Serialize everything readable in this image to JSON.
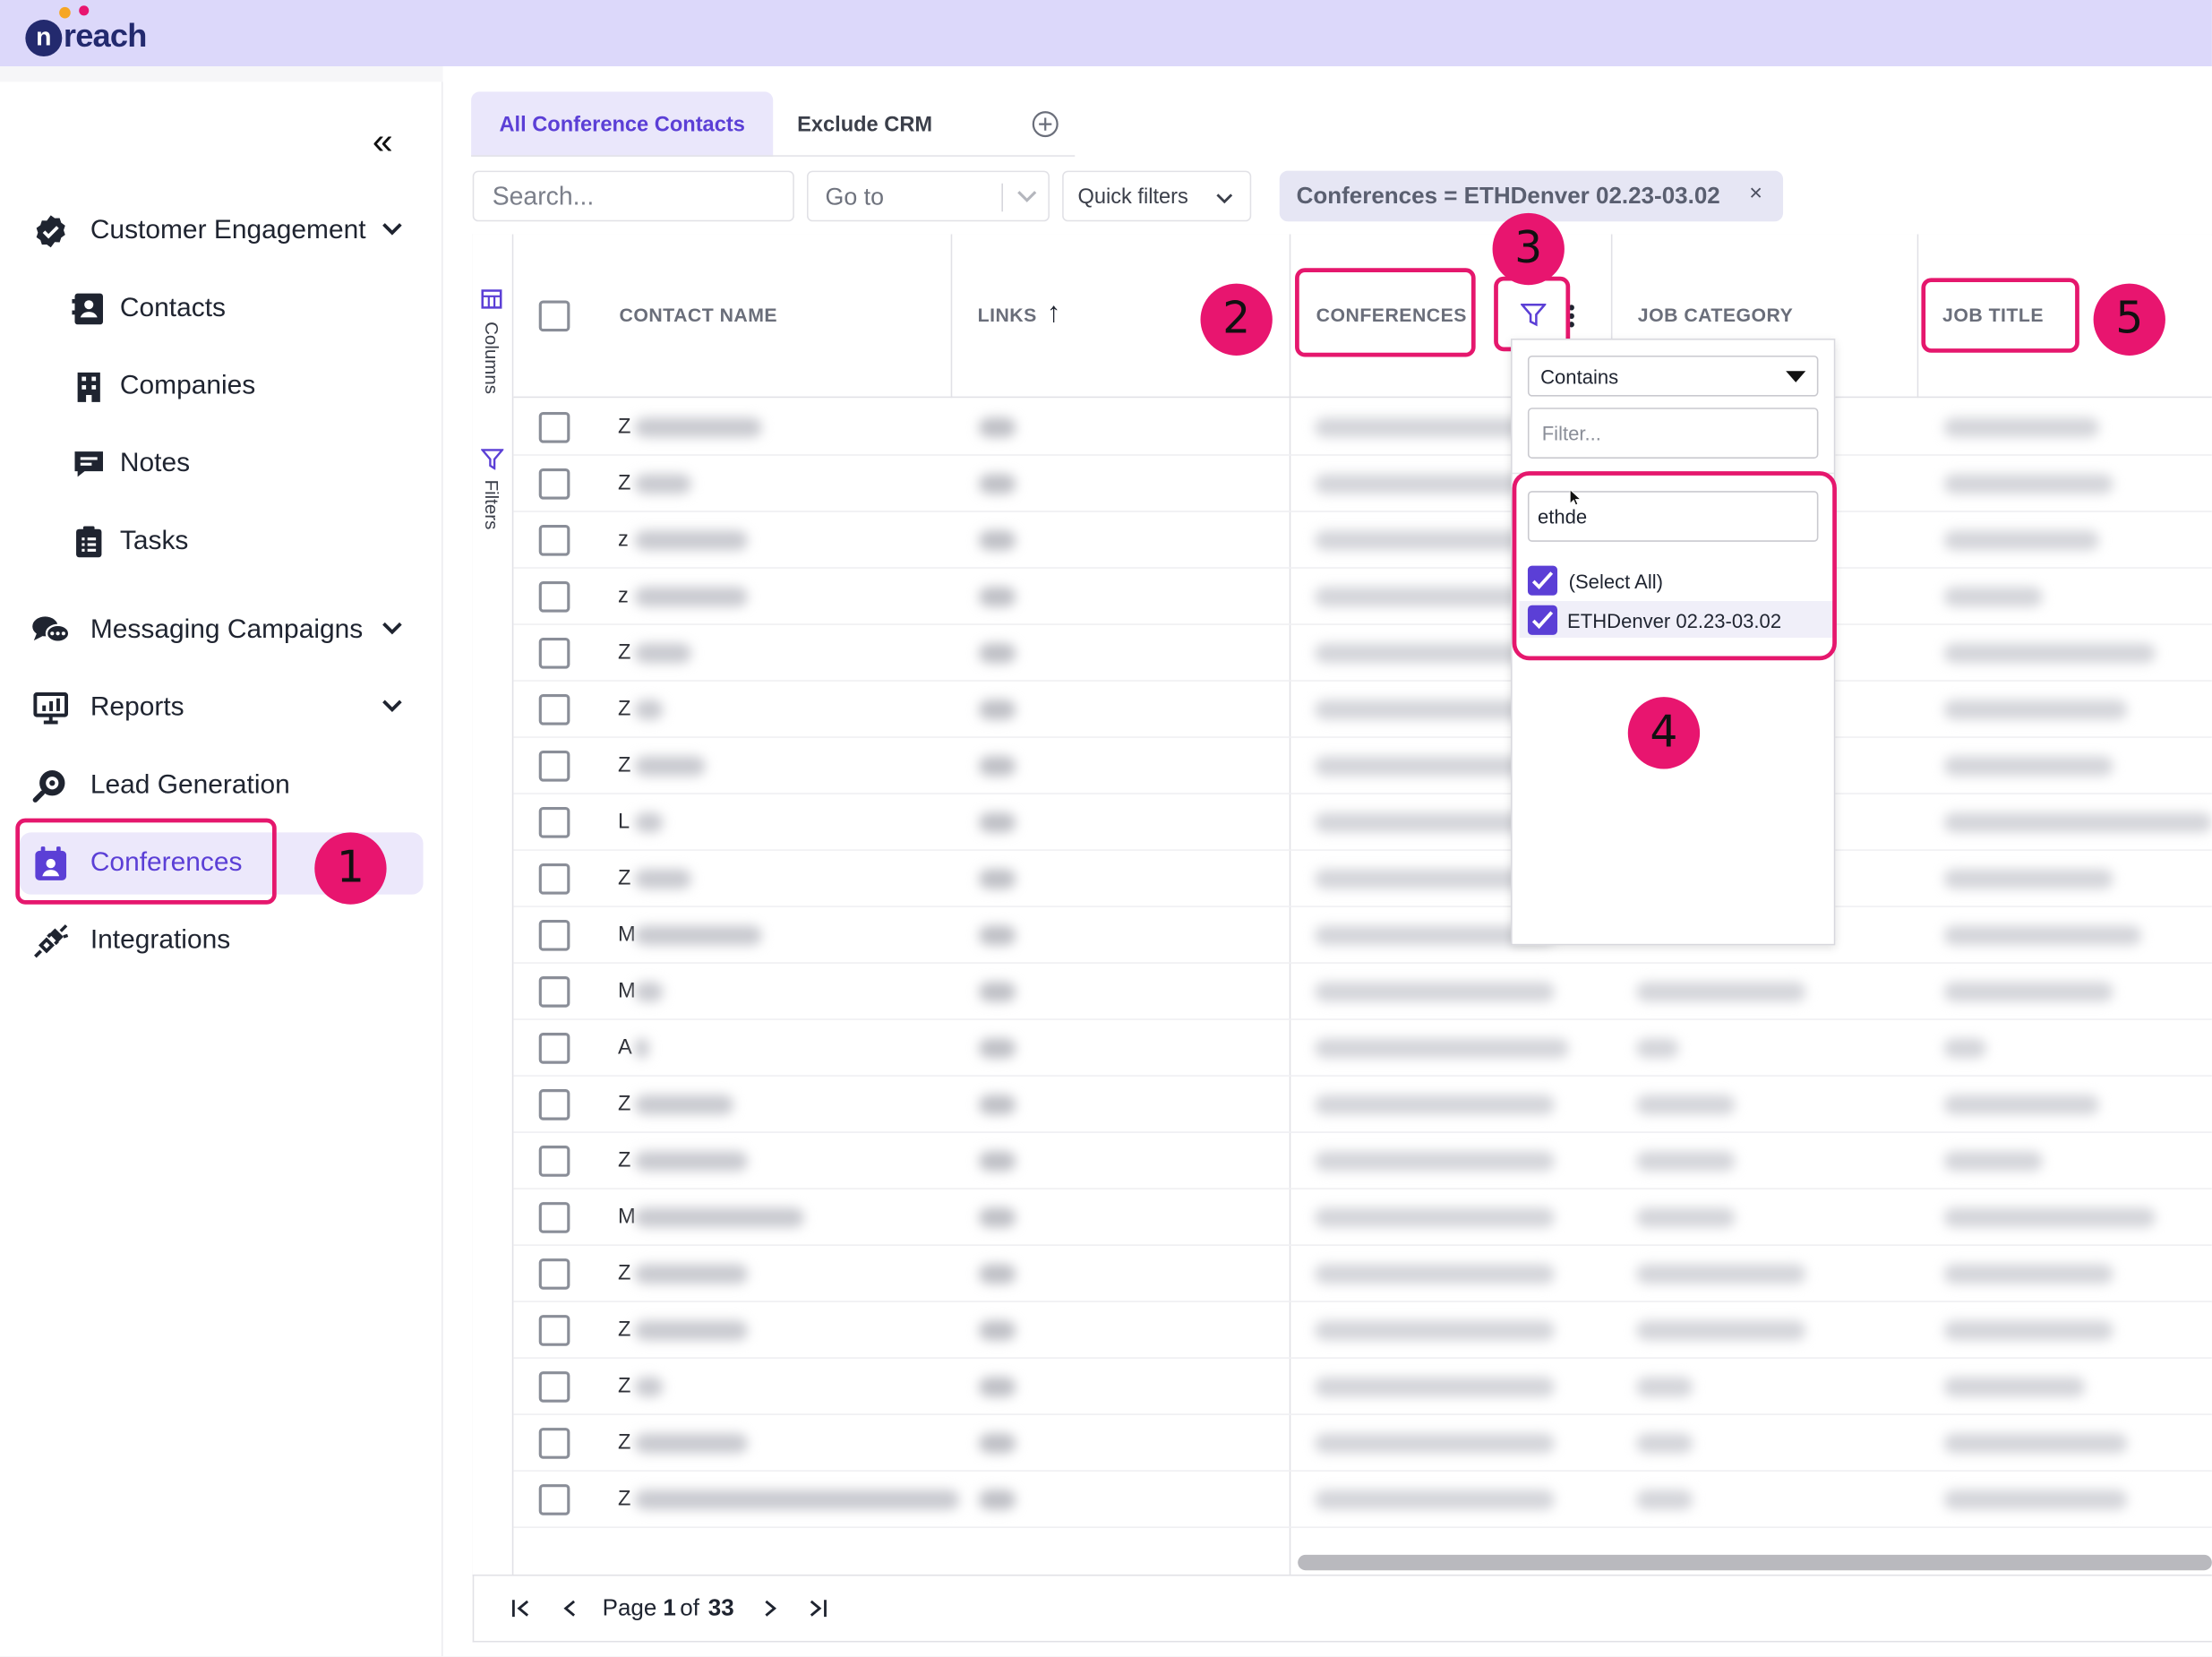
{
  "app": {
    "logo_text": "reach",
    "logo_letter": "n"
  },
  "sidebar": {
    "collapse_glyph": "«",
    "items": [
      {
        "label": "Customer Engagement",
        "icon": "check-badge-icon",
        "expandable": true
      },
      {
        "label": "Contacts",
        "icon": "contact-card-icon"
      },
      {
        "label": "Companies",
        "icon": "building-icon"
      },
      {
        "label": "Notes",
        "icon": "note-icon"
      },
      {
        "label": "Tasks",
        "icon": "clipboard-icon"
      },
      {
        "label": "Messaging Campaigns",
        "icon": "chat-bubbles-icon",
        "expandable": true
      },
      {
        "label": "Reports",
        "icon": "presentation-icon",
        "expandable": true
      },
      {
        "label": "Lead Generation",
        "icon": "search-magnifier-icon"
      },
      {
        "label": "Conferences",
        "icon": "calendar-person-icon",
        "active": true
      },
      {
        "label": "Integrations",
        "icon": "plug-icon"
      }
    ]
  },
  "tabs": [
    {
      "label": "All Conference Contacts",
      "active": true
    },
    {
      "label": "Exclude CRM"
    }
  ],
  "toolbar": {
    "search_placeholder": "Search...",
    "goto_placeholder": "Go to",
    "quick_filters_label": "Quick filters",
    "active_filter_chip": "Conferences = ETHDenver 02.23-03.02",
    "chip_close": "×"
  },
  "side_tools": {
    "columns_label": "Columns",
    "filters_label": "Filters"
  },
  "grid": {
    "columns": [
      "CONTACT NAME",
      "LINKS",
      "CONFERENCES",
      "JOB CATEGORY",
      "JOB TITLE"
    ],
    "sort_arrow": "↑",
    "row_initials": [
      "Z",
      "Z",
      "z",
      "z",
      "Z",
      "Z",
      "Z",
      "L",
      "Z",
      "M",
      "M",
      "A",
      "Z",
      "Z",
      "M",
      "Z",
      "Z",
      "Z",
      "Z",
      "Z"
    ]
  },
  "filter_popup": {
    "operator": "Contains",
    "filter_placeholder": "Filter...",
    "search_value": "ethde",
    "options": [
      {
        "label": "(Select All)",
        "checked": true
      },
      {
        "label": "ETHDenver 02.23-03.02",
        "checked": true
      }
    ]
  },
  "annotations": [
    "1",
    "2",
    "3",
    "4",
    "5"
  ],
  "pagination": {
    "page_word": "Page",
    "current": "1",
    "of_word": "of",
    "total": "33"
  },
  "colors": {
    "accent": "#5b3fd6",
    "highlight": "#e5176d",
    "topbar": "#dcd8fa"
  }
}
